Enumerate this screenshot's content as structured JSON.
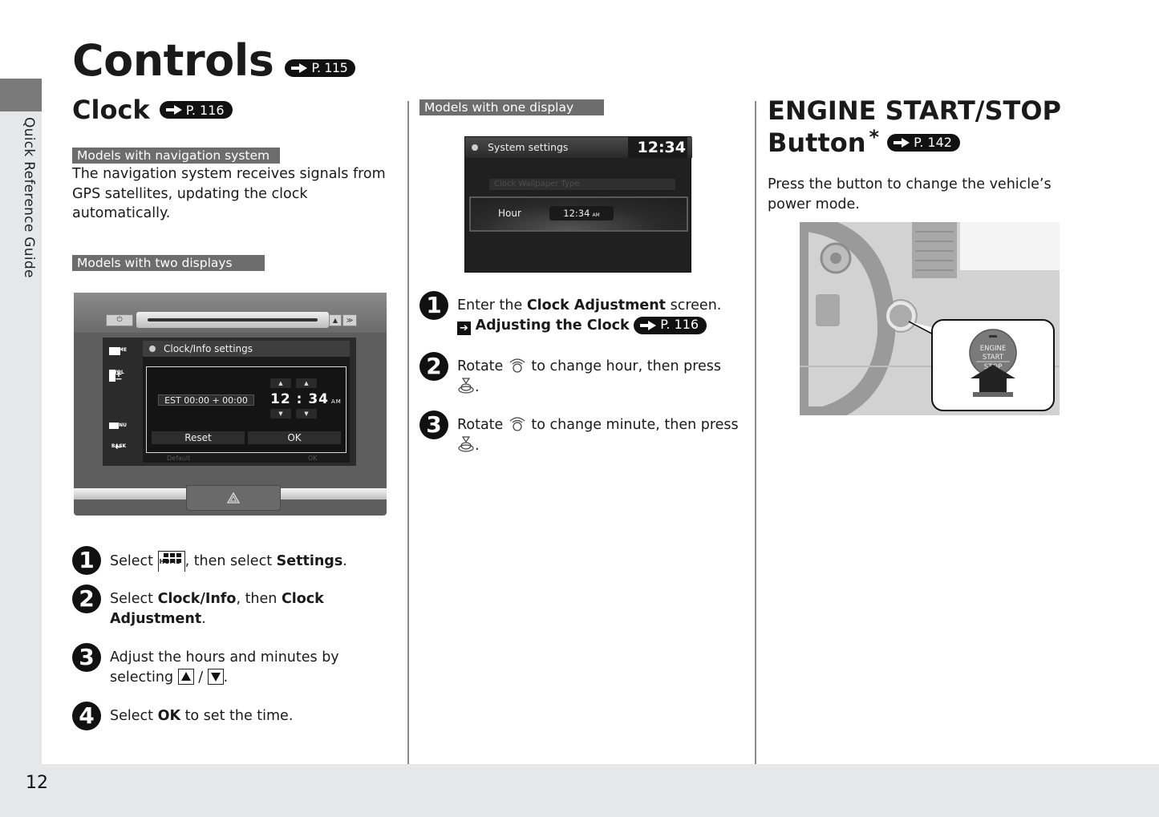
{
  "side_tab": {
    "label": "Quick Reference Guide"
  },
  "page_number": "12",
  "title": {
    "text": "Controls",
    "ref": "P. 115"
  },
  "clock": {
    "heading": "Clock",
    "ref": "P. 116",
    "nav_band": "Models with navigation system",
    "nav_text": "The navigation system receives signals from GPS satellites, updating the clock automatically.",
    "two_band": "Models with two displays",
    "device": {
      "screen_title": "Clock/Info settings",
      "timezone": "EST 00:00 + 00:00",
      "hour": "12",
      "minute": "34",
      "ampm": "AM",
      "reset_label": "Reset",
      "ok_label": "OK",
      "ghost_default": "Default",
      "ghost_ok": "OK",
      "side_keys": [
        "HOME",
        "VOL",
        "MENU",
        "BACK"
      ]
    },
    "steps": [
      {
        "n": "1",
        "pre": "Select ",
        "key": "HOME",
        "mid": ", then select ",
        "bold": "Settings",
        "post": "."
      },
      {
        "n": "2",
        "pre": "Select ",
        "bold1": "Clock/Info",
        "mid": ", then ",
        "bold2": "Clock Adjustment",
        "post": "."
      },
      {
        "n": "3",
        "pre": "Adjust the hours and minutes by selecting ",
        "sep": " / ",
        "post": "."
      },
      {
        "n": "4",
        "pre": "Select ",
        "bold": "OK",
        "post": " to set the time."
      }
    ]
  },
  "one_display": {
    "band": "Models with one display",
    "screen": {
      "title": "System settings",
      "clock": "12:34",
      "faded_item": "Clock Wallpaper Type",
      "row_label": "Hour",
      "row_value": "12:34",
      "row_ampm": "AM"
    },
    "steps": [
      {
        "n": "1",
        "pre": "Enter the ",
        "bold": "Clock Adjustment",
        "post": " screen.",
        "link_text": "Adjusting the Clock",
        "link_ref": "P. 116"
      },
      {
        "n": "2",
        "pre": "Rotate ",
        "mid": " to change hour, then press ",
        "post": "."
      },
      {
        "n": "3",
        "pre": "Rotate ",
        "mid": " to change minute, then press ",
        "post": "."
      }
    ]
  },
  "engine": {
    "heading_line1": "ENGINE START/STOP",
    "heading_line2": "Button",
    "asterisk": "*",
    "ref": "P. 142",
    "text": "Press the button to change the vehicle’s power mode.",
    "button_text": [
      "ENGINE",
      "START",
      "STOP"
    ]
  }
}
